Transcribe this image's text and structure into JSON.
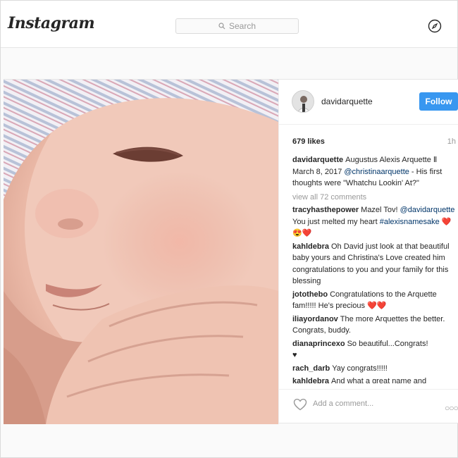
{
  "nav": {
    "logo": "Instagram",
    "search_placeholder": "Search",
    "search_icon": "search-icon",
    "explore_icon": "compass-icon"
  },
  "post": {
    "author": "davidarquette",
    "follow_label": "Follow",
    "likes": "679 likes",
    "time": "1h",
    "caption": {
      "user": "davidarquette",
      "text_before": "Augustus Alexis Arquette Ⅱ March 8, 2017 ",
      "mention": "@christinaarquette",
      "text_after": " - His first thoughts were \"Whatchu Lookin' At?\""
    },
    "view_all": "view all 72 comments",
    "comments": [
      {
        "user": "tracyhasthepower",
        "text": "Mazel Tov!",
        "mention": "@davidarquette",
        "text2": " You just melted my heart ",
        "tag": "#alexisnamesake",
        "emoji": " ❤️😍❤️"
      },
      {
        "user": "kahldebra",
        "text": "Oh David just look at that beautiful baby yours and Christina's Love created him congratulations to you and your family for this blessing"
      },
      {
        "user": "jotothebo",
        "text": "Congratulations to the Arquette fam!!!!! He's precious",
        "emoji": " ❤️❤️"
      },
      {
        "user": "iliayordanov",
        "text": "The more Arquettes the better. Congrats, buddy."
      },
      {
        "user": "dianaprincexo",
        "text": "So beautiful...Congrats!",
        "emoji": "♥"
      },
      {
        "user": "rach_darb",
        "text": "Yay congrats!!!!!"
      },
      {
        "user": "kahldebra",
        "text": "And what a great name and"
      }
    ],
    "add_comment_placeholder": "Add a comment...",
    "like_icon": "heart-outline-icon",
    "more_icon": "more-options-icon",
    "more_glyph": "○○○"
  }
}
